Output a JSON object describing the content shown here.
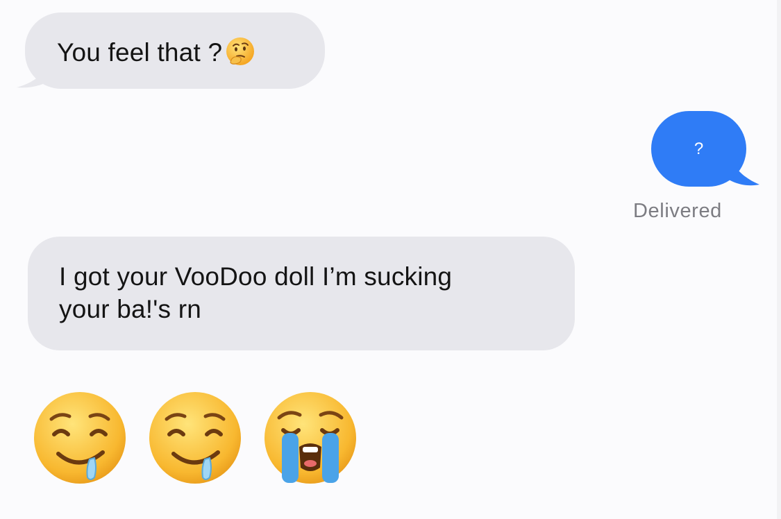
{
  "messages": [
    {
      "direction": "incoming",
      "text": "You feel that ?",
      "trailing_emoji": "thinking-face"
    },
    {
      "direction": "outgoing",
      "text": "?",
      "status": "Delivered"
    },
    {
      "direction": "incoming",
      "lines": [
        "I got your VooDoo doll I’m sucking",
        "your ba!'s rn"
      ]
    }
  ],
  "emoji_row": [
    "drooling-face",
    "drooling-face",
    "loudly-crying-face"
  ],
  "colors": {
    "incoming_bubble": "#e7e7ec",
    "outgoing_bubble": "#2f7cf6",
    "status_text": "#7c7c82",
    "background": "#fbfbfd"
  }
}
